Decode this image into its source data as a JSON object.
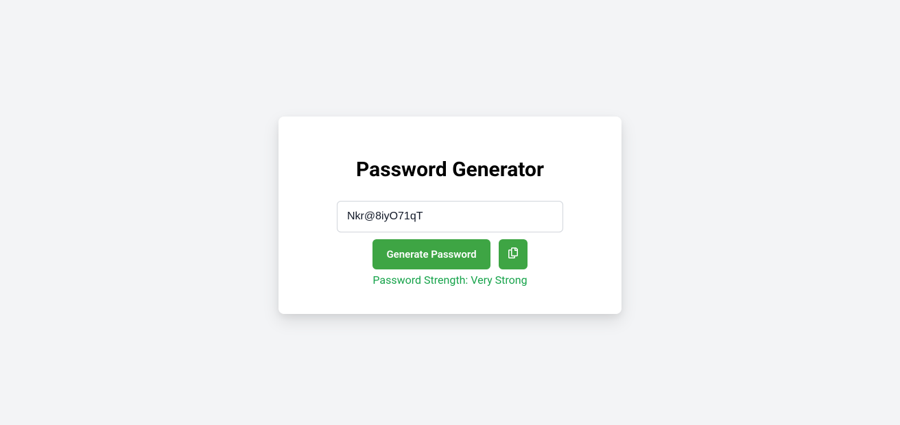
{
  "title": "Password Generator",
  "password": {
    "value": "Nkr@8iyO71qT"
  },
  "buttons": {
    "generate_label": "Generate Password"
  },
  "strength": {
    "text": "Password Strength: Very Strong",
    "color": "#16a34a"
  },
  "colors": {
    "accent": "#3ea544",
    "background": "#f3f4f6"
  }
}
